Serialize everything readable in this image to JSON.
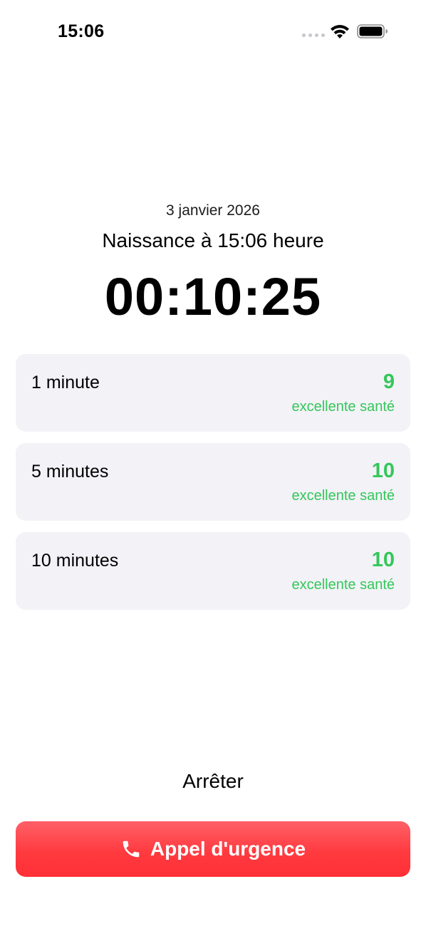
{
  "status_bar": {
    "time": "15:06"
  },
  "header": {
    "date": "3 janvier 2026",
    "birth_label": "Naissance à 15:06 heure",
    "timer": "00:10:25"
  },
  "scores": [
    {
      "label": "1 minute",
      "score": "9",
      "status": "excellente santé"
    },
    {
      "label": "5 minutes",
      "score": "10",
      "status": "excellente santé"
    },
    {
      "label": "10 minutes",
      "score": "10",
      "status": "excellente santé"
    }
  ],
  "actions": {
    "stop_label": "Arrêter",
    "emergency_label": "Appel d'urgence"
  },
  "colors": {
    "score_green": "#34c759",
    "card_background": "#f2f2f7",
    "emergency_red": "#ff3b40"
  },
  "icons": {
    "wifi": "wifi-icon",
    "battery": "battery-icon",
    "signal": "signal-dots-icon",
    "phone": "phone-icon"
  }
}
